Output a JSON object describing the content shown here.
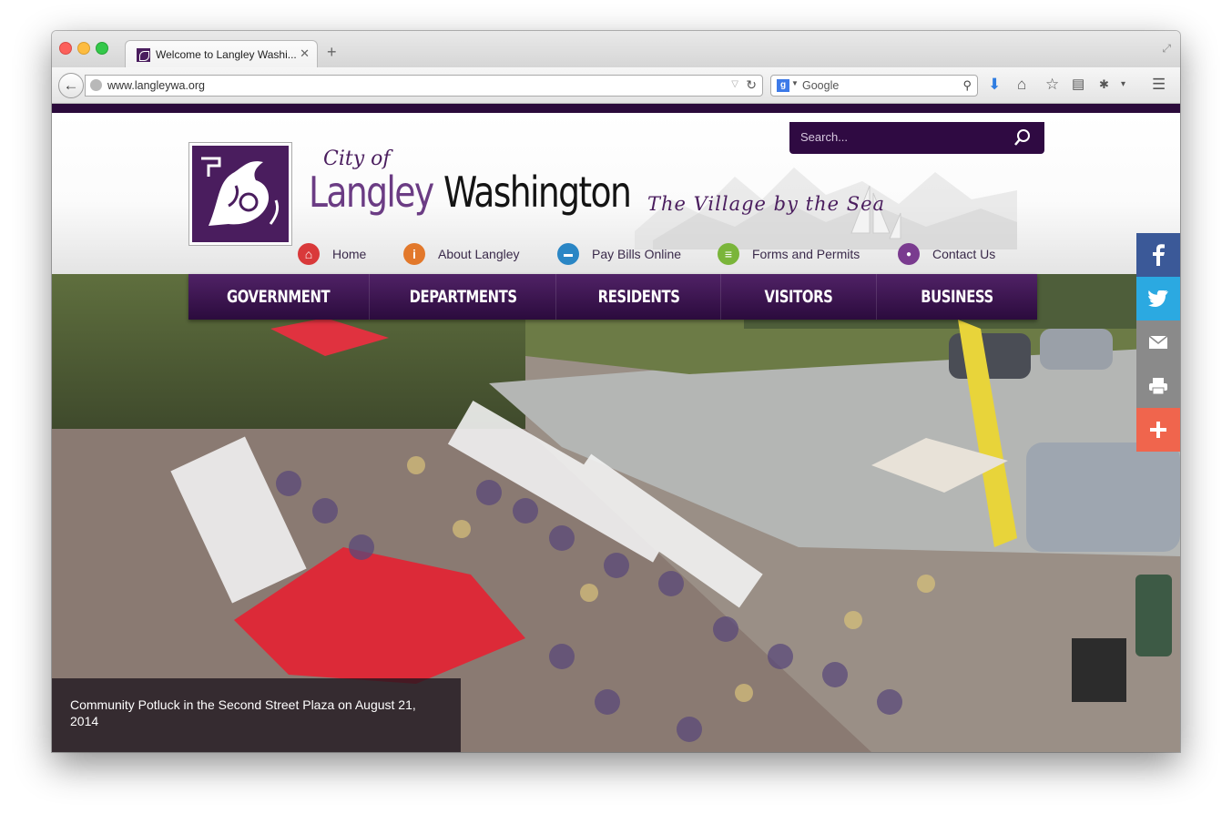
{
  "browser": {
    "tab_title": "Welcome to Langley Washi...",
    "tab_close": "✕",
    "new_tab": "+",
    "url": "www.langleywa.org",
    "search_engine": "Google",
    "search_engine_letter": "g",
    "toolbar_icons": [
      "download-icon",
      "home-icon",
      "bookmark-star-icon",
      "reading-list-icon",
      "addon-icon",
      "menu-icon"
    ]
  },
  "site": {
    "search_placeholder": "Search...",
    "logo": {
      "city_of": "City of",
      "name_part1": "Langley",
      "name_part2": "Washington",
      "tagline": "The Village by the Sea"
    },
    "quick_links": [
      {
        "label": "Home",
        "icon": "home-icon",
        "color": "#d9393a",
        "glyph": "⌂"
      },
      {
        "label": "About Langley",
        "icon": "info-icon",
        "color": "#e2782b",
        "glyph": "i"
      },
      {
        "label": "Pay Bills Online",
        "icon": "credit-card-icon",
        "color": "#2a86c5",
        "glyph": "▬"
      },
      {
        "label": "Forms and Permits",
        "icon": "document-icon",
        "color": "#7ab53a",
        "glyph": "≡"
      },
      {
        "label": "Contact Us",
        "icon": "person-icon",
        "color": "#7a3b8f",
        "glyph": "●"
      }
    ],
    "main_nav": [
      "GOVERNMENT",
      "DEPARTMENTS",
      "RESIDENTS",
      "VISITORS",
      "BUSINESS"
    ],
    "hero_caption": "Community Potluck in the Second Street Plaza on August 21, 2014",
    "social": [
      {
        "name": "facebook",
        "color": "#3b5998",
        "glyph": "f"
      },
      {
        "name": "twitter",
        "color": "#2ba9e1",
        "glyph": "t"
      },
      {
        "name": "email",
        "color": "#8a8a8a",
        "glyph": "✉"
      },
      {
        "name": "print",
        "color": "#8a8a8a",
        "glyph": "⎙"
      },
      {
        "name": "more",
        "color": "#f0654d",
        "glyph": "+"
      }
    ]
  }
}
